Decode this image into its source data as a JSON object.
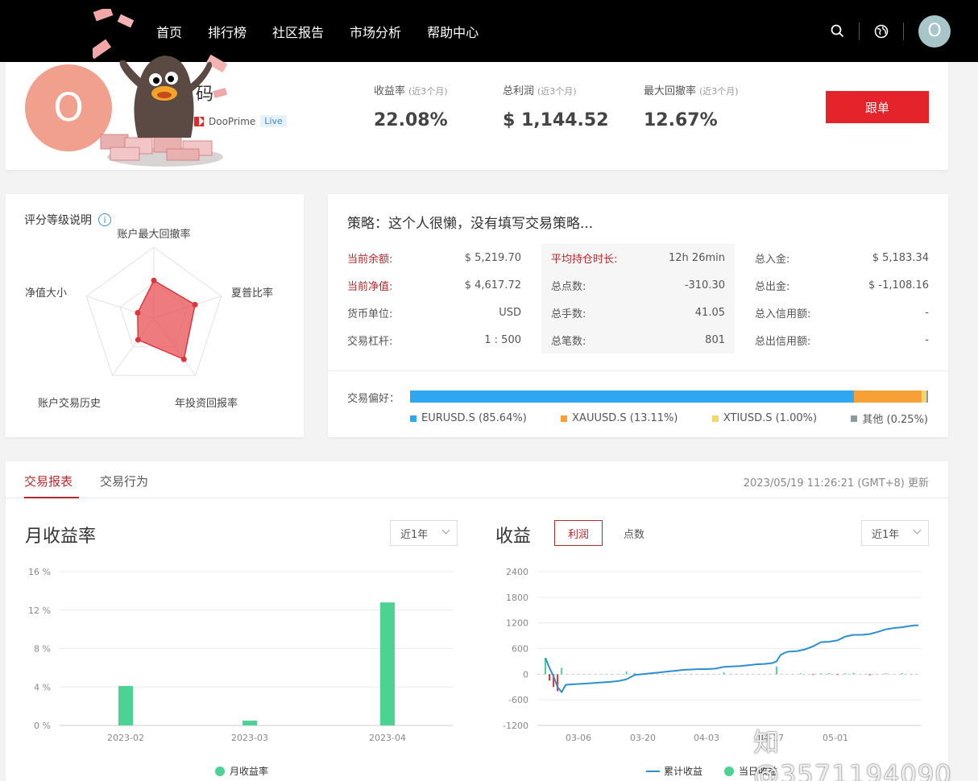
{
  "nav": {
    "links": [
      "首页",
      "排行榜",
      "社区报告",
      "市场分析",
      "帮助中心"
    ],
    "avatar_letter": "O"
  },
  "profile": {
    "avatar_letter": "O",
    "name": "码",
    "broker": "DooPrime",
    "badge": "Live",
    "kpis": [
      {
        "label": "收益率",
        "sub": "(近3个月)",
        "value": "22.08%"
      },
      {
        "label": "总利润",
        "sub": "(近3个月)",
        "value": "$ 1,144.52"
      },
      {
        "label": "最大回撤率",
        "sub": "(近3个月)",
        "value": "12.67%"
      }
    ],
    "follow_label": "跟单"
  },
  "radar": {
    "title": "评分等级说明",
    "info_glyph": "i",
    "axes": [
      "账户最大回撤率",
      "夏普比率",
      "年投资回报率",
      "账户交易历史",
      "净值大小"
    ],
    "scores": [
      0.53,
      0.61,
      0.72,
      0.38,
      0.24
    ]
  },
  "strategy": {
    "title": "策略：这个人很懒，没有填写交易策略...",
    "col1": [
      {
        "label": "当前余额:",
        "value": "$ 5,219.70",
        "red": true
      },
      {
        "label": "当前净值:",
        "value": "$ 4,617.72",
        "red": true
      },
      {
        "label": "货币单位:",
        "value": "USD",
        "red": false
      },
      {
        "label": "交易杠杆:",
        "value": "1 : 500",
        "red": false
      }
    ],
    "col2": [
      {
        "label": "平均持仓时长:",
        "value": "12h 26min",
        "red": true
      },
      {
        "label": "总点数:",
        "value": "-310.30",
        "red": false
      },
      {
        "label": "总手数:",
        "value": "41.05",
        "red": false
      },
      {
        "label": "总笔数:",
        "value": "801",
        "red": false
      }
    ],
    "col3": [
      {
        "label": "总入金:",
        "value": "$ 5,183.34",
        "red": false
      },
      {
        "label": "总出金:",
        "value": "$ -1,108.16",
        "red": false
      },
      {
        "label": "总入信用额:",
        "value": "-",
        "red": false
      },
      {
        "label": "总出信用额:",
        "value": "-",
        "red": false
      }
    ],
    "pref_label": "交易偏好：",
    "preferences": [
      {
        "name": "EURUSD.S (85.64%)",
        "pct": 85.64,
        "color": "#2ea6f2"
      },
      {
        "name": "XAUUSD.S (13.11%)",
        "pct": 13.11,
        "color": "#f7a035"
      },
      {
        "name": "XTIUSD.S (1.00%)",
        "pct": 1.0,
        "color": "#f7d56b"
      },
      {
        "name": "其他 (0.25%)",
        "pct": 0.25,
        "color": "#8c9aa0"
      }
    ]
  },
  "report": {
    "tabs": [
      "交易报表",
      "交易行为"
    ],
    "update_time": "2023/05/19 11:26:21 (GMT+8) 更新",
    "monthly_title": "月收益率",
    "monthly_select": "近1年",
    "profit_title": "收益",
    "profit_toggle_on": "利润",
    "profit_toggle_off": "点数",
    "profit_select": "近1年"
  },
  "chart_data": [
    {
      "type": "bar",
      "categories": [
        "2023-02",
        "2023-03",
        "2023-04"
      ],
      "values": [
        4.1,
        0.5,
        12.8
      ],
      "title": "",
      "xlabel": "",
      "ylabel": "",
      "ylim": [
        0,
        16
      ],
      "yticks": [
        "16 %",
        "12 %",
        "8 %",
        "4 %",
        "0 %"
      ],
      "series": [
        {
          "name": "月收益率",
          "values": [
            4.1,
            0.5,
            12.8
          ]
        }
      ],
      "color": "#4cd394",
      "legend": "bottom",
      "grid": true
    },
    {
      "type": "line",
      "title": "",
      "ylim": [
        -1200,
        2400
      ],
      "yticks": [
        "2400",
        "1800",
        "1200",
        "600",
        "0",
        "-600",
        "-1200"
      ],
      "xticks": [
        "03-06",
        "03-20",
        "04-03",
        "04-17",
        "05-01"
      ],
      "legend": "bottom",
      "grid": true,
      "series": [
        {
          "name": "累计收益",
          "color": "#2d8fd0",
          "points": [
            [
              0,
              380
            ],
            [
              1,
              150
            ],
            [
              2,
              -50
            ],
            [
              3,
              -300
            ],
            [
              4,
              -420
            ],
            [
              5,
              -250
            ],
            [
              6,
              -240
            ],
            [
              8,
              -230
            ],
            [
              10,
              -220
            ],
            [
              13,
              -200
            ],
            [
              16,
              -180
            ],
            [
              18,
              -160
            ],
            [
              20,
              -120
            ],
            [
              22,
              -20
            ],
            [
              24,
              0
            ],
            [
              26,
              20
            ],
            [
              28,
              40
            ],
            [
              30,
              60
            ],
            [
              32,
              80
            ],
            [
              34,
              100
            ],
            [
              36,
              110
            ],
            [
              38,
              120
            ],
            [
              40,
              120
            ],
            [
              42,
              130
            ],
            [
              44,
              170
            ],
            [
              46,
              180
            ],
            [
              48,
              190
            ],
            [
              50,
              210
            ],
            [
              52,
              230
            ],
            [
              54,
              240
            ],
            [
              56,
              260
            ],
            [
              57,
              300
            ],
            [
              58,
              450
            ],
            [
              59,
              500
            ],
            [
              60,
              530
            ],
            [
              62,
              540
            ],
            [
              64,
              580
            ],
            [
              66,
              650
            ],
            [
              68,
              750
            ],
            [
              70,
              760
            ],
            [
              72,
              790
            ],
            [
              74,
              880
            ],
            [
              76,
              920
            ],
            [
              78,
              920
            ],
            [
              80,
              940
            ],
            [
              82,
              990
            ],
            [
              84,
              1050
            ],
            [
              86,
              1080
            ],
            [
              88,
              1100
            ],
            [
              90,
              1130
            ],
            [
              91,
              1140
            ],
            [
              92,
              1144
            ]
          ]
        },
        {
          "name": "当日收益",
          "color": "#4cd394",
          "bars": [
            [
              0,
              380
            ],
            [
              1,
              -150
            ],
            [
              2,
              -300
            ],
            [
              3,
              -400
            ],
            [
              4,
              150
            ],
            [
              20,
              60
            ],
            [
              22,
              30
            ],
            [
              44,
              40
            ],
            [
              57,
              180
            ],
            [
              63,
              20
            ],
            [
              66,
              -20
            ],
            [
              68,
              15
            ],
            [
              70,
              25
            ],
            [
              72,
              -20
            ],
            [
              74,
              20
            ],
            [
              76,
              30
            ],
            [
              80,
              -25
            ],
            [
              84,
              20
            ],
            [
              88,
              25
            ]
          ]
        }
      ]
    }
  ]
}
